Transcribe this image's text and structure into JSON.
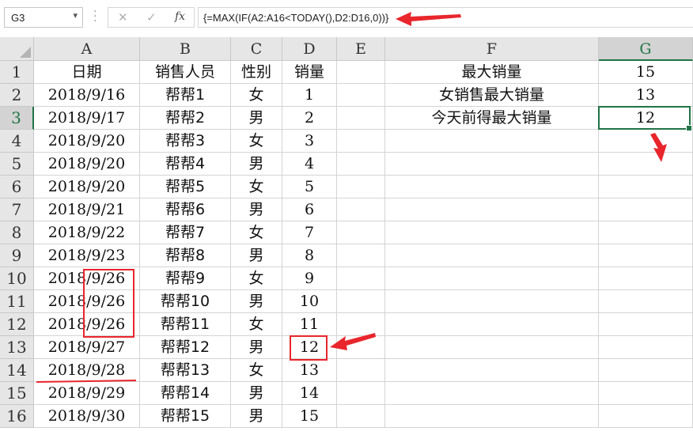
{
  "formula_bar": {
    "name_box": "G3",
    "name_box_icon": "chevron-down-icon",
    "cancel_icon": "close-icon",
    "enter_icon": "check-icon",
    "function_icon": "function-icon",
    "fx_label": "fx",
    "formula": "{=MAX(IF(A2:A16<TODAY(),D2:D16,0))}"
  },
  "columns": [
    "A",
    "B",
    "C",
    "D",
    "E",
    "F",
    "G"
  ],
  "rows": [
    {
      "n": "1",
      "A": "日期",
      "B": "销售人员",
      "C": "性别",
      "D": "销量"
    },
    {
      "n": "2",
      "A": "2018/9/16",
      "B": "帮帮1",
      "C": "女",
      "D": "1"
    },
    {
      "n": "3",
      "A": "2018/9/17",
      "B": "帮帮2",
      "C": "男",
      "D": "2"
    },
    {
      "n": "4",
      "A": "2018/9/20",
      "B": "帮帮3",
      "C": "女",
      "D": "3"
    },
    {
      "n": "5",
      "A": "2018/9/20",
      "B": "帮帮4",
      "C": "男",
      "D": "4"
    },
    {
      "n": "6",
      "A": "2018/9/20",
      "B": "帮帮5",
      "C": "女",
      "D": "5"
    },
    {
      "n": "7",
      "A": "2018/9/21",
      "B": "帮帮6",
      "C": "男",
      "D": "6"
    },
    {
      "n": "8",
      "A": "2018/9/22",
      "B": "帮帮7",
      "C": "女",
      "D": "7"
    },
    {
      "n": "9",
      "A": "2018/9/23",
      "B": "帮帮8",
      "C": "男",
      "D": "8"
    },
    {
      "n": "10",
      "A": "2018/9/26",
      "B": "帮帮9",
      "C": "女",
      "D": "9"
    },
    {
      "n": "11",
      "A": "2018/9/26",
      "B": "帮帮10",
      "C": "男",
      "D": "10"
    },
    {
      "n": "12",
      "A": "2018/9/26",
      "B": "帮帮11",
      "C": "女",
      "D": "11"
    },
    {
      "n": "13",
      "A": "2018/9/27",
      "B": "帮帮12",
      "C": "男",
      "D": "12"
    },
    {
      "n": "14",
      "A": "2018/9/28",
      "B": "帮帮13",
      "C": "女",
      "D": "13"
    },
    {
      "n": "15",
      "A": "2018/9/29",
      "B": "帮帮14",
      "C": "男",
      "D": "14"
    },
    {
      "n": "16",
      "A": "2018/9/30",
      "B": "帮帮15",
      "C": "男",
      "D": "15"
    }
  ],
  "summary": [
    {
      "label": "最大销量",
      "value": "15"
    },
    {
      "label": "女销售最大销量",
      "value": "13"
    },
    {
      "label": "今天前得最大销量",
      "value": "12"
    }
  ],
  "selected_cell": "G3",
  "colors": {
    "selection": "#217346",
    "annotation": "#e8262c",
    "header_bg": "#e6e6e6"
  }
}
